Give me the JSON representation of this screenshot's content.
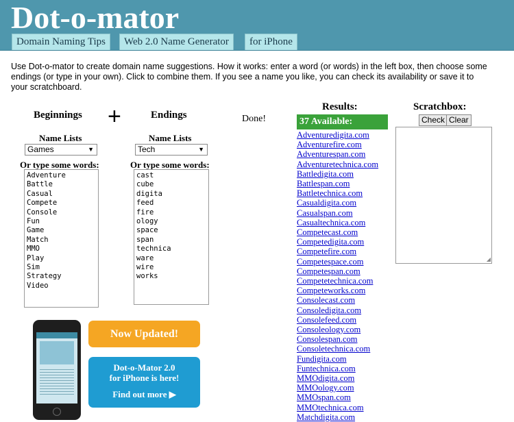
{
  "header": {
    "logo": "Dot-o-mator",
    "tabs": [
      "Domain Naming Tips",
      "Web 2.0 Name Generator",
      "for iPhone"
    ]
  },
  "intro": "Use Dot-o-mator to create domain name suggestions. How it works: enter a word (or words) in the left box, then choose some endings (or type in your own). Click to combine them. If you see a name you like, you can check its availability or save it to your scratchboard.",
  "beginnings": {
    "heading": "Beginnings",
    "list_label": "Name Lists",
    "selected_list": "Games",
    "type_label": "Or type some words:",
    "words": [
      "Adventure",
      "Battle",
      "Casual",
      "Compete",
      "Console",
      "Fun",
      "Game",
      "Match",
      "MMO",
      "Play",
      "Sim",
      "Strategy",
      "Video"
    ]
  },
  "plus": "+",
  "endings": {
    "heading": "Endings",
    "list_label": "Name Lists",
    "selected_list": "Tech",
    "type_label": "Or type some words:",
    "words": [
      "cast",
      "cube",
      "digita",
      "feed",
      "fire",
      "ology",
      "space",
      "span",
      "technica",
      "ware",
      "wire",
      "works"
    ]
  },
  "done_label": "Done!",
  "results": {
    "title": "Results:",
    "available": "37 Available:",
    "names": [
      "Adventuredigita.com",
      "Adventurefire.com",
      "Adventurespan.com",
      "Adventuretechnica.com",
      "Battledigita.com",
      "Battlespan.com",
      "Battletechnica.com",
      "Casualdigita.com",
      "Casualspan.com",
      "Casualtechnica.com",
      "Competecast.com",
      "Competedigita.com",
      "Competefire.com",
      "Competespace.com",
      "Competespan.com",
      "Competetechnica.com",
      "Competeworks.com",
      "Consolecast.com",
      "Consoledigita.com",
      "Consolefeed.com",
      "Consoleology.com",
      "Consolespan.com",
      "Consoletechnica.com",
      "Fundigita.com",
      "Funtechnica.com",
      "MMOdigita.com",
      "MMOology.com",
      "MMOspan.com",
      "MMOtechnica.com",
      "Matchdigita.com"
    ]
  },
  "scratch": {
    "title": "Scratchbox:",
    "check_label": "Check",
    "clear_label": "Clear"
  },
  "promo": {
    "now_updated": "Now Updated!",
    "line1": "Dot-o-Mator 2.0",
    "line2": "for iPhone is here!",
    "find_more": "Find out more ▶"
  },
  "colors": {
    "header_bg": "#4f97ad",
    "tab_bg": "#b5e6ea",
    "available_bg": "#3aa23a",
    "promo_orange": "#f5a623",
    "promo_blue": "#1f9cd2",
    "link": "#0000cc"
  }
}
